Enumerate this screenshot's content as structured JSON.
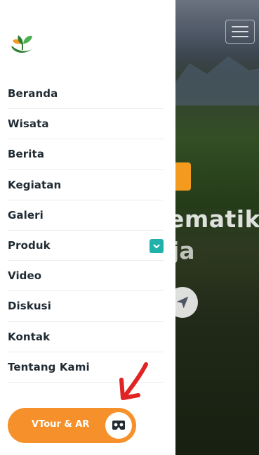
{
  "drawer": {
    "menu_items": [
      {
        "label": "Beranda"
      },
      {
        "label": "Wisata"
      },
      {
        "label": "Berita"
      },
      {
        "label": "Kegiatan"
      },
      {
        "label": "Galeri"
      },
      {
        "label": "Produk",
        "has_dropdown": true
      },
      {
        "label": "Video"
      },
      {
        "label": "Diskusi"
      },
      {
        "label": "Kontak"
      },
      {
        "label": "Tentang Kami"
      }
    ],
    "vtour_label": "VTour & AR",
    "vtour_icon": "vr-headset-icon"
  },
  "background": {
    "headline_line1": "ematik",
    "headline_line2": "ja"
  },
  "colors": {
    "accent_orange": "#f5902a",
    "dropdown_teal": "#20b2aa",
    "arrow_red": "#e02424"
  }
}
